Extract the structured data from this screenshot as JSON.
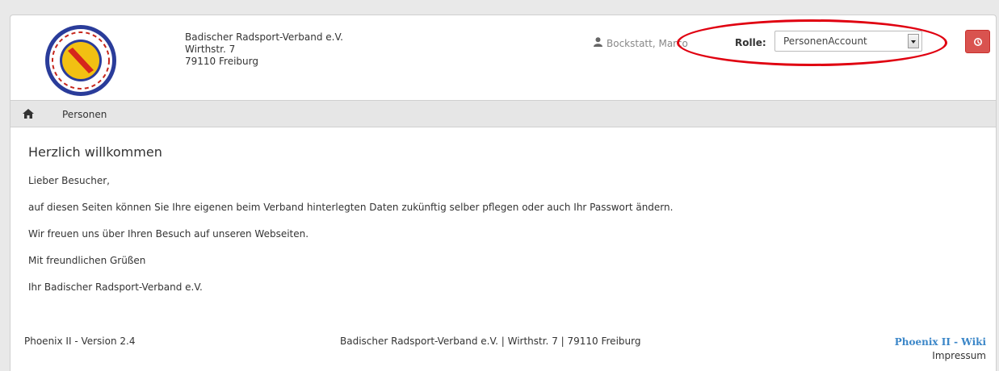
{
  "header": {
    "org_name": "Badischer Radsport-Verband e.V.",
    "org_street": "Wirthstr. 7",
    "org_city": "79110 Freiburg",
    "user_name": "Bockstatt, Marco",
    "role_label": "Rolle:",
    "role_value": "PersonenAccount",
    "icons": {
      "user": "user-icon",
      "power": "power-icon"
    }
  },
  "nav": {
    "home_icon": "home-icon",
    "item_label": "Personen"
  },
  "content": {
    "title": "Herzlich willkommen",
    "paragraphs": [
      "Lieber Besucher,",
      "auf diesen Seiten können Sie Ihre eigenen beim Verband hinterlegten Daten zukünftig selber pflegen oder auch Ihr Passwort ändern.",
      "Wir freuen uns über Ihren Besuch auf unseren Webseiten.",
      "Mit freundlichen Grüßen",
      "Ihr Badischer Radsport-Verband e.V."
    ]
  },
  "footer": {
    "version": "Phoenix II - Version 2.4",
    "address": "Badischer Radsport-Verband e.V. | Wirthstr. 7 | 79110 Freiburg",
    "wiki": "Phoenix II - Wiki",
    "impressum": "Impressum"
  },
  "colors": {
    "accent_red": "#d9534f",
    "annotation_red": "#e00010",
    "link_blue": "#3a86c8"
  }
}
